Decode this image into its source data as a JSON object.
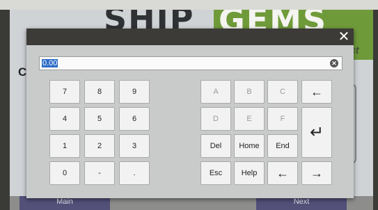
{
  "background": {
    "brand_left": "SHIP",
    "brand_right": "GEMS",
    "brand_sub": "act",
    "side_label": "Ca",
    "nav_main": "Main",
    "nav_next": "Next"
  },
  "dialog": {
    "close_icon": "close-icon",
    "input_value": "0.00",
    "clear_icon": "clear-icon"
  },
  "numpad": {
    "row1": [
      "7",
      "8",
      "9"
    ],
    "row2": [
      "4",
      "5",
      "6"
    ],
    "row3": [
      "1",
      "2",
      "3"
    ],
    "row4": [
      "0",
      "-",
      "."
    ]
  },
  "hexpad": {
    "row1": [
      "A",
      "B",
      "C"
    ],
    "row2": [
      "D",
      "E",
      "F"
    ],
    "row3": [
      "Del",
      "Home",
      "End"
    ],
    "row4": [
      "Esc",
      "Help"
    ]
  },
  "arrows": {
    "backspace": "←",
    "enter": "↵",
    "left": "←",
    "right": "→"
  },
  "colors": {
    "title_bar": "#3c3b38",
    "brand_green": "#6f9a3a",
    "nav_button": "#53507a",
    "selection": "#2d6cc7"
  }
}
